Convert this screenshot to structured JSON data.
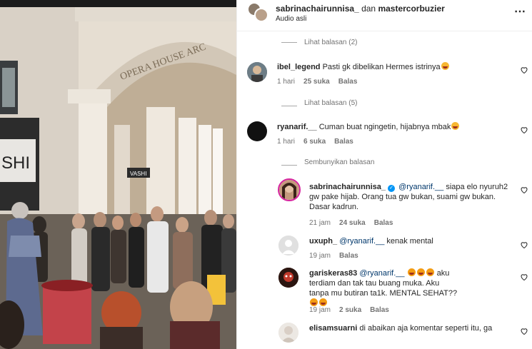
{
  "header": {
    "user1": "sabrinachairunnisa_",
    "connector": "dan",
    "user2": "mastercorbuzier",
    "audio": "Audio asli",
    "more_icon": "more-horizontal-icon"
  },
  "photo": {
    "arch_sign": "OPERA HOUSE ARC",
    "shop_sign": "SHI",
    "small_sign": "VASHI"
  },
  "threads": [
    {
      "view_replies": "Lihat balasan (2)"
    },
    {
      "view_replies": "Lihat balasan (5)"
    },
    {
      "hide_replies": "Sembunyikan balasan"
    }
  ],
  "comments": [
    {
      "user": "ibel_legend",
      "text": "Pasti gk dibelikan Hermes istrinya",
      "time": "1 hari",
      "likes": "25 suka",
      "reply": "Balas"
    },
    {
      "user": "ryanarif.__",
      "text": "Cuman buat ngingetin, hijabnya mbak",
      "time": "1 hari",
      "likes": "6 suka",
      "reply": "Balas"
    }
  ],
  "replies": [
    {
      "user": "sabrinachairunnisa_",
      "mention": "@ryanarif.__",
      "text": "siapa elo nyuruh2 gw pake hijab. Orang tua gw bukan, suami gw bukan. Dasar kadrun.",
      "time": "21 jam",
      "likes": "24 suka",
      "reply": "Balas"
    },
    {
      "user": "uxuph_",
      "mention": "@ryanarif.__",
      "text": "kenak mental",
      "time": "19 jam",
      "reply": "Balas"
    },
    {
      "user": "gariskeras83",
      "mention": "@ryanarif.__",
      "text": "aku terdiam dan tak tau buang muka. Aku tanpa mu butiran ta1k. MENTAL SEHAT??",
      "time": "19 jam",
      "likes": "2 suka",
      "reply": "Balas"
    },
    {
      "user": "elisamsuarni",
      "text": "di abaikan aja komentar seperti itu, ga"
    }
  ],
  "colors": {
    "link": "#00376b",
    "secondary": "#737373",
    "verified": "#0095f6"
  }
}
